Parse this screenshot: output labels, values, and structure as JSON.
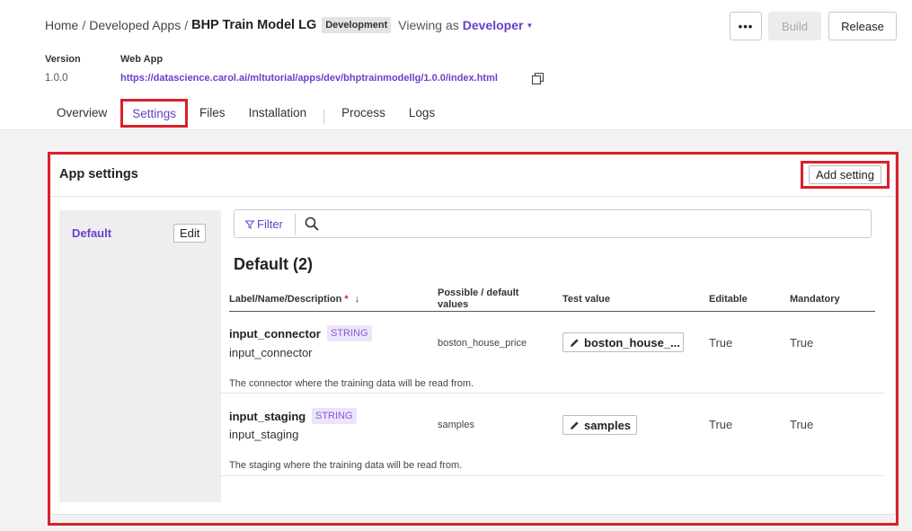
{
  "breadcrumb": {
    "home": "Home",
    "developed_apps": "Developed Apps",
    "current": "BHP Train Model LG",
    "env_badge": "Development",
    "viewing_label": "Viewing as",
    "viewing_role": "Developer"
  },
  "header_actions": {
    "more": "•••",
    "build": "Build",
    "release": "Release"
  },
  "meta": {
    "version_label": "Version",
    "version_value": "1.0.0",
    "webapp_label": "Web App",
    "webapp_url": "https://datascience.carol.ai/mltutorial/apps/dev/bhptrainmodellg/1.0.0/index.html"
  },
  "tabs": [
    {
      "label": "Overview"
    },
    {
      "label": "Settings",
      "active": true
    },
    {
      "label": "Files"
    },
    {
      "label": "Installation"
    },
    {
      "label": "Process"
    },
    {
      "label": "Logs"
    }
  ],
  "app_settings": {
    "title": "App settings",
    "add_button": "Add setting",
    "sidebar": {
      "group": "Default",
      "edit_button": "Edit"
    },
    "search": {
      "filter_label": "Filter",
      "placeholder": ""
    },
    "group_title": "Default (2)",
    "columns": {
      "label": "Label/Name/Description",
      "required_mark": "*",
      "sort_icon": "↓",
      "possible_1": "Possible / default",
      "possible_2": "values",
      "test": "Test value",
      "editable": "Editable",
      "mandatory": "Mandatory"
    },
    "rows": [
      {
        "label": "input_connector",
        "type": "STRING",
        "name": "input_connector",
        "default": "boston_house_price",
        "test_value": "boston_house_...",
        "editable": "True",
        "mandatory": "True",
        "description": "The connector where the training data will be read from."
      },
      {
        "label": "input_staging",
        "type": "STRING",
        "name": "input_staging",
        "default": "samples",
        "test_value": "samples",
        "editable": "True",
        "mandatory": "True",
        "description": "The staging where the training data will be read from."
      }
    ]
  },
  "colors": {
    "accent": "#6a3fc8",
    "highlight": "#d9202a"
  }
}
